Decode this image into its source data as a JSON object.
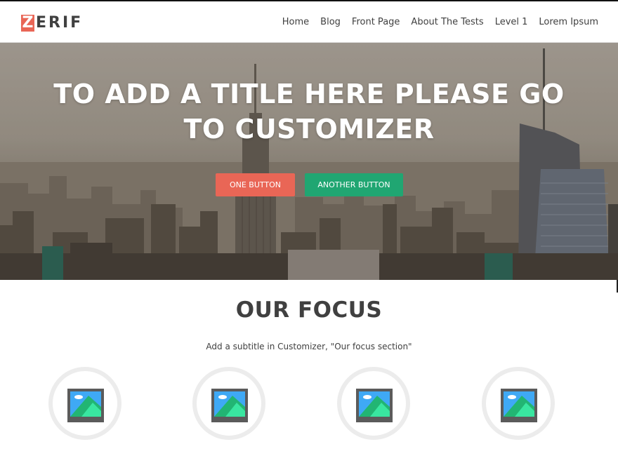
{
  "logo": {
    "first": "Z",
    "rest": "ERIF"
  },
  "nav": [
    "Home",
    "Blog",
    "Front Page",
    "About The Tests",
    "Level 1",
    "Lorem Ipsum"
  ],
  "hero": {
    "title": "TO ADD A TITLE HERE PLEASE GO TO CUSTOMIZER",
    "button_one": "ONE BUTTON",
    "button_two": "ANOTHER BUTTON"
  },
  "focus": {
    "title": "OUR FOCUS",
    "subtitle": "Add a subtitle in Customizer, \"Our focus section\"",
    "items": [
      {
        "icon": "image-placeholder-icon"
      },
      {
        "icon": "image-placeholder-icon"
      },
      {
        "icon": "image-placeholder-icon"
      },
      {
        "icon": "image-placeholder-icon"
      }
    ]
  },
  "colors": {
    "accent_red": "#e96656",
    "accent_green": "#20a672",
    "text_dark": "#404040"
  }
}
